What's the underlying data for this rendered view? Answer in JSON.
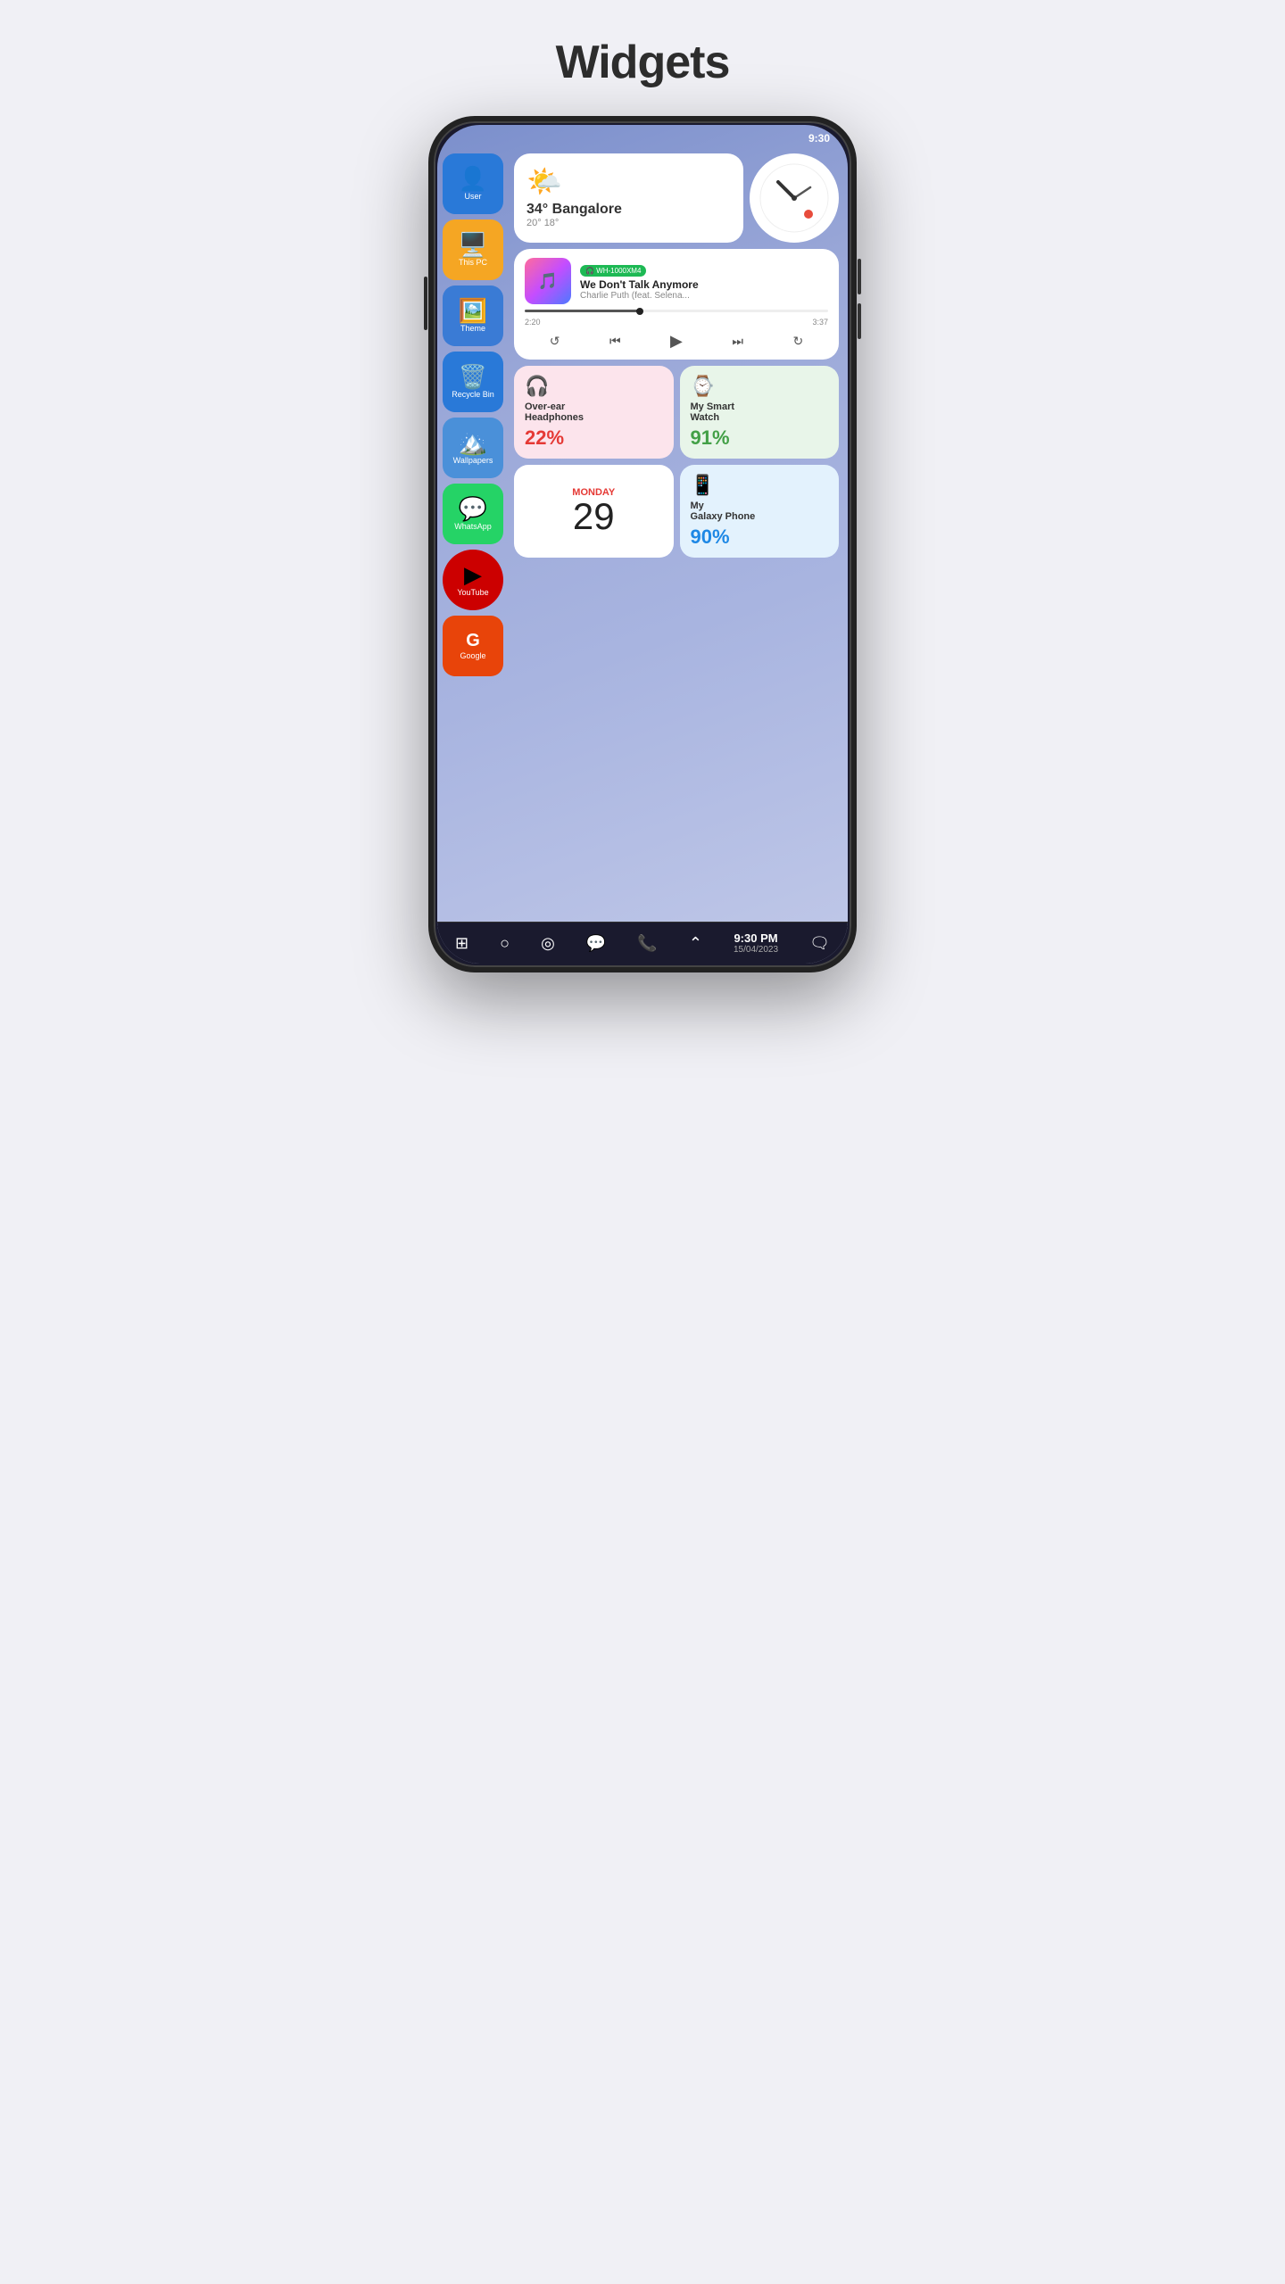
{
  "page": {
    "title": "Widgets"
  },
  "sidebar": {
    "apps": [
      {
        "label": "User",
        "icon": "👤",
        "color": "app-blue"
      },
      {
        "label": "This PC",
        "icon": "🖥️",
        "color": "app-orange"
      },
      {
        "label": "Theme",
        "icon": "🖼️",
        "color": "app-blue2"
      },
      {
        "label": "Recycle Bin",
        "icon": "🗑️",
        "color": "app-blue3"
      },
      {
        "label": "Wallpapers",
        "icon": "🏔️",
        "color": "app-blue4"
      },
      {
        "label": "WhatsApp",
        "icon": "💬",
        "color": "app-green"
      },
      {
        "label": "YouTube",
        "icon": "▶",
        "color": "app-red-dark"
      },
      {
        "label": "Google",
        "icon": "G",
        "color": "app-orange2"
      }
    ]
  },
  "widgets": {
    "weather": {
      "temp": "34° Bangalore",
      "sub": "20°  18°",
      "icon": "🌤️"
    },
    "clock": {
      "hour_angle": 135,
      "minute_angle": 300
    },
    "music": {
      "badge": "🎧 WH-1000XM4",
      "title": "We Don't Talk Anymore",
      "artist": "Charlie Puth (feat. Selena...",
      "current_time": "2:20",
      "total_time": "3:37",
      "art_icon": "🎵"
    },
    "headphones": {
      "name": "Over-ear\nHeadphones",
      "pct": "22%",
      "icon": "🎧"
    },
    "smartwatch": {
      "name": "My Smart\nWatch",
      "pct": "91%",
      "icon": "⌚"
    },
    "calendar": {
      "day": "MONDAY",
      "date": "29"
    },
    "phone": {
      "name": "My\nGalaxy Phone",
      "pct": "90%",
      "icon": "📱"
    }
  },
  "navbar": {
    "time": "9:30 PM",
    "date": "15/04/2023"
  }
}
